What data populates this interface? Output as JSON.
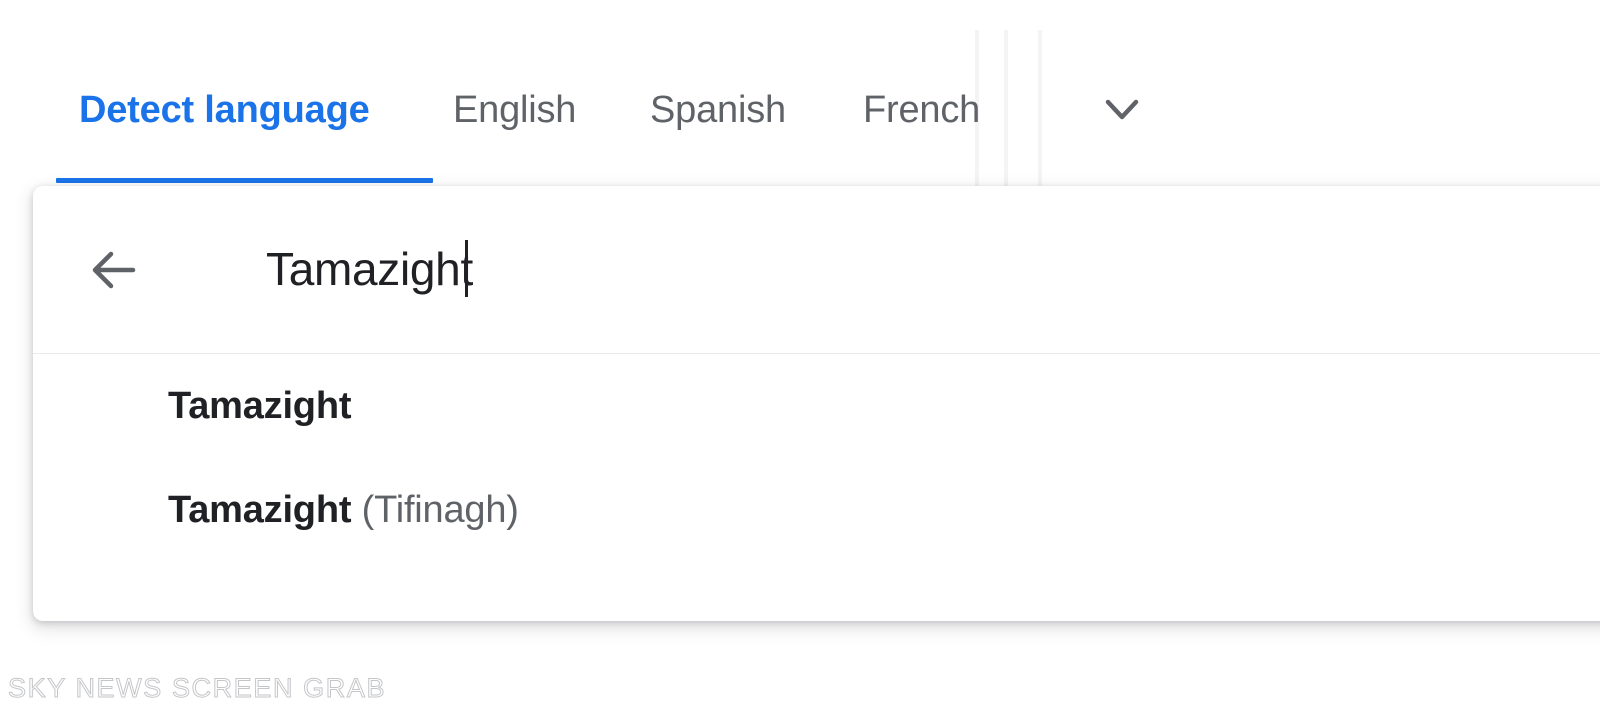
{
  "language_tabs": {
    "items": [
      {
        "label": "Detect language",
        "active": true
      },
      {
        "label": "English",
        "active": false
      },
      {
        "label": "Spanish",
        "active": false
      },
      {
        "label": "French",
        "active": false
      }
    ],
    "expand_icon": "chevron-down-icon",
    "active_color": "#1a73e8",
    "inactive_color": "#5f6368"
  },
  "language_picker": {
    "back_icon": "arrow-left-icon",
    "search": {
      "value": "Tamazight",
      "placeholder": "Search languages"
    },
    "results": [
      {
        "name": "Tamazight",
        "suffix": ""
      },
      {
        "name": "Tamazight",
        "suffix": " (Tifinagh)"
      }
    ]
  },
  "watermark": {
    "text": "SKY NEWS SCREEN GRAB"
  }
}
